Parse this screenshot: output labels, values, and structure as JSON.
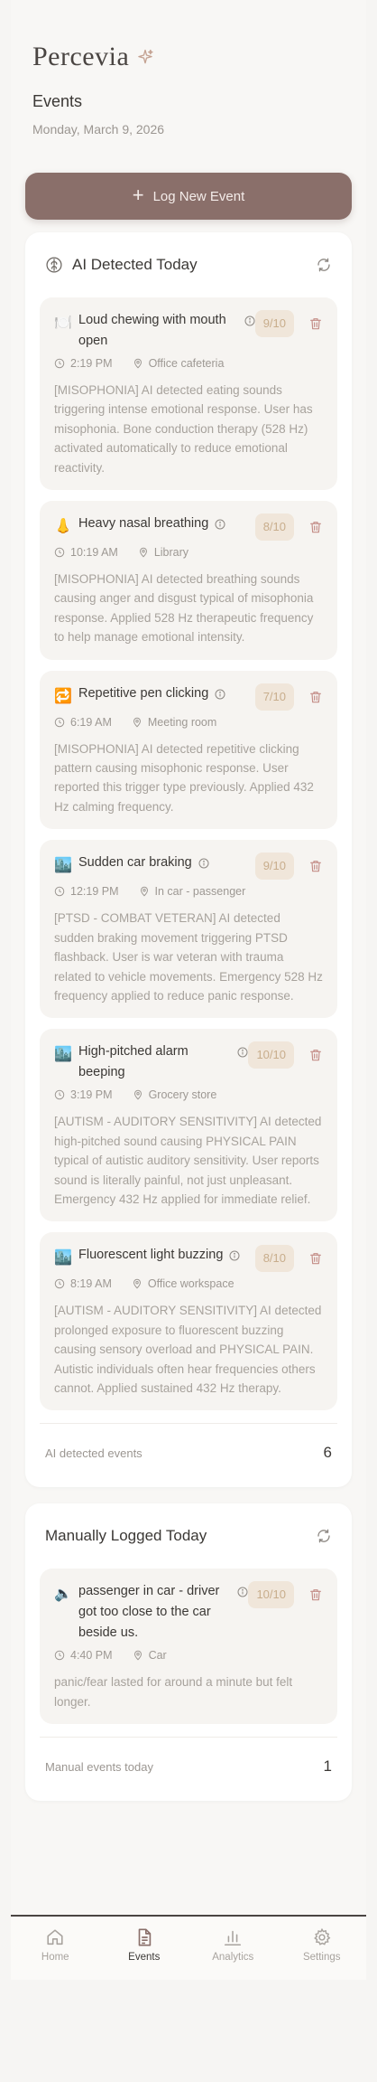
{
  "app": {
    "name": "Percevia"
  },
  "page": {
    "title": "Events",
    "date": "Monday, March 9, 2026"
  },
  "log_button": {
    "label": "Log New Event"
  },
  "ai_section": {
    "title": "AI Detected Today",
    "footer_label": "AI detected events",
    "count": "6",
    "events": [
      {
        "icon": "fork-knife-plate-icon",
        "emoji": "🍽️",
        "title": "Loud chewing with mouth open",
        "intensity": "9/10",
        "time": "2:19 PM",
        "location": "Office cafeteria",
        "description": "[MISOPHONIA] AI detected eating sounds triggering intense emotional response. User has misophonia. Bone conduction therapy (528 Hz) activated automatically to reduce emotional reactivity."
      },
      {
        "icon": "nose-icon",
        "emoji": "👃",
        "title": "Heavy nasal breathing",
        "intensity": "8/10",
        "time": "10:19 AM",
        "location": "Library",
        "description": "[MISOPHONIA] AI detected breathing sounds causing anger and disgust typical of misophonia response. Applied 528 Hz therapeutic frequency to help manage emotional intensity."
      },
      {
        "icon": "repeat-icon",
        "emoji": "🔁",
        "title": "Repetitive pen clicking",
        "intensity": "7/10",
        "time": "6:19 AM",
        "location": "Meeting room",
        "description": "[MISOPHONIA] AI detected repetitive clicking pattern causing misophonic response. User reported this trigger type previously. Applied 432 Hz calming frequency."
      },
      {
        "icon": "city-icon",
        "emoji": "🏙️",
        "title": "Sudden car braking",
        "intensity": "9/10",
        "time": "12:19 PM",
        "location": "In car - passenger",
        "description": "[PTSD - COMBAT VETERAN] AI detected sudden braking movement triggering PTSD flashback. User is war veteran with trauma related to vehicle movements. Emergency 528 Hz frequency applied to reduce panic response."
      },
      {
        "icon": "city-icon",
        "emoji": "🏙️",
        "title": "High-pitched alarm beeping",
        "intensity": "10/10",
        "time": "3:19 PM",
        "location": "Grocery store",
        "description": "[AUTISM - AUDITORY SENSITIVITY] AI detected high-pitched sound causing PHYSICAL PAIN typical of autistic auditory sensitivity. User reports sound is literally painful, not just unpleasant. Emergency 432 Hz applied for immediate relief."
      },
      {
        "icon": "city-icon",
        "emoji": "🏙️",
        "title": "Fluorescent light buzzing",
        "intensity": "8/10",
        "time": "8:19 AM",
        "location": "Office workspace",
        "description": "[AUTISM - AUDITORY SENSITIVITY] AI detected prolonged exposure to fluorescent buzzing causing sensory overload and PHYSICAL PAIN. Autistic individuals often hear frequencies others cannot. Applied sustained 432 Hz therapy."
      }
    ]
  },
  "manual_section": {
    "title": "Manually Logged Today",
    "footer_label": "Manual events today",
    "count": "1",
    "events": [
      {
        "icon": "speaker-icon",
        "emoji": "🔈",
        "title": "passenger in car - driver got too close to the car beside us.",
        "intensity": "10/10",
        "time": "4:40 PM",
        "location": "Car",
        "description": "panic/fear lasted for around a minute but felt longer."
      }
    ]
  },
  "nav": {
    "items": [
      {
        "label": "Home",
        "icon": "home-icon"
      },
      {
        "label": "Events",
        "icon": "document-icon",
        "active": true
      },
      {
        "label": "Analytics",
        "icon": "bar-chart-icon"
      },
      {
        "label": "Settings",
        "icon": "gear-icon"
      }
    ]
  },
  "colors": {
    "accent": "#8a6f6a",
    "badge_bg": "#f0e6da",
    "badge_text": "#c8ad8c"
  }
}
